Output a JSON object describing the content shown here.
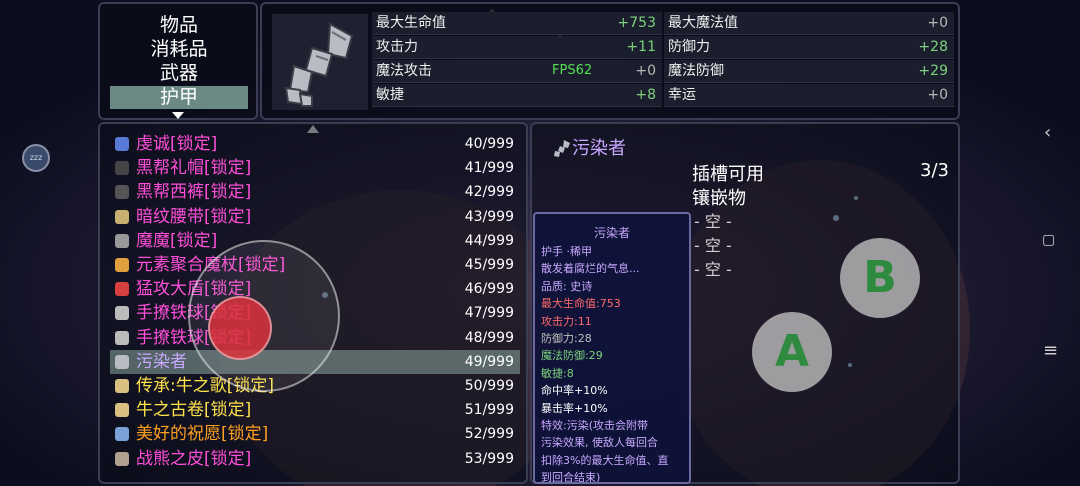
{
  "categories": [
    {
      "label": "物品",
      "selected": false
    },
    {
      "label": "消耗品",
      "selected": false
    },
    {
      "label": "武器",
      "selected": false
    },
    {
      "label": "护甲",
      "selected": true
    }
  ],
  "stats": {
    "left": [
      {
        "label": "最大生命值",
        "value": "+753",
        "color": "green"
      },
      {
        "label": "攻击力",
        "value": "+11",
        "color": "green"
      },
      {
        "label": "魔法攻击",
        "value": "+0",
        "color": "gray"
      },
      {
        "label": "敏捷",
        "value": "+8",
        "color": "green"
      }
    ],
    "right": [
      {
        "label": "最大魔法值",
        "value": "+0",
        "color": "gray"
      },
      {
        "label": "防御力",
        "value": "+28",
        "color": "green"
      },
      {
        "label": "魔法防御",
        "value": "+29",
        "color": "green"
      },
      {
        "label": "幸运",
        "value": "+0",
        "color": "gray"
      }
    ],
    "fps": "FPS62"
  },
  "items": [
    {
      "name": "虔诚[锁定]",
      "count": "40/999",
      "color": "#ff4fd8",
      "icon": "blue-robe-icon",
      "selected": false
    },
    {
      "name": "黑帮礼帽[锁定]",
      "count": "41/999",
      "color": "#ff4fd8",
      "icon": "top-hat-icon",
      "selected": false
    },
    {
      "name": "黑帮西裤[锁定]",
      "count": "42/999",
      "color": "#ff4fd8",
      "icon": "trousers-icon",
      "selected": false
    },
    {
      "name": "暗纹腰带[锁定]",
      "count": "43/999",
      "color": "#ff4fd8",
      "icon": "belt-icon",
      "selected": false
    },
    {
      "name": "魔魔[锁定]",
      "count": "44/999",
      "color": "#ff4fd8",
      "icon": "wand-icon",
      "selected": false
    },
    {
      "name": "元素聚合魔杖[锁定]",
      "count": "45/999",
      "color": "#ff4fd8",
      "icon": "magic-staff-icon",
      "selected": false
    },
    {
      "name": "猛攻大盾[锁定]",
      "count": "46/999",
      "color": "#ff4fd8",
      "icon": "shield-icon",
      "selected": false
    },
    {
      "name": "手撩铁球[锁定]",
      "count": "47/999",
      "color": "#ff4fd8",
      "icon": "iron-ball-icon",
      "selected": false
    },
    {
      "name": "手撩铁球[锁定]",
      "count": "48/999",
      "color": "#ff4fd8",
      "icon": "iron-ball-icon",
      "selected": false
    },
    {
      "name": "污染者",
      "count": "49/999",
      "color": "#c8a8ff",
      "icon": "gauntlet-icon",
      "selected": true
    },
    {
      "name": "传承:牛之歌[锁定]",
      "count": "50/999",
      "color": "#ffe14a",
      "icon": "scroll-icon",
      "selected": false
    },
    {
      "name": "牛之古卷[锁定]",
      "count": "51/999",
      "color": "#ffe14a",
      "icon": "scroll-icon",
      "selected": false
    },
    {
      "name": "美好的祝愿[锁定]",
      "count": "52/999",
      "color": "#ffa020",
      "icon": "ring-icon",
      "selected": false
    },
    {
      "name": "战熊之皮[锁定]",
      "count": "53/999",
      "color": "#ff4fd8",
      "icon": "bear-skin-icon",
      "selected": false
    }
  ],
  "detail": {
    "name": "污染者",
    "slot_title_1": "插槽可用",
    "slot_title_2": "镶嵌物",
    "slot_count": "3/3",
    "slots": [
      "- 空 -",
      "- 空 -",
      "- 空 -"
    ]
  },
  "tooltip": {
    "title": "污染者",
    "lines": [
      {
        "text": "护手 ·稀甲",
        "color": "#c8a8ff"
      },
      {
        "text": "散发着腐烂的气息...",
        "color": "#c8a8ff"
      },
      {
        "text": "品质: 史诗",
        "color": "#c8a8ff"
      },
      {
        "text": "最大生命值:753",
        "color": "#ff6a6a"
      },
      {
        "text": "攻击力:11",
        "color": "#ff6a6a"
      },
      {
        "text": "防御力:28",
        "color": "#c0c0c0"
      },
      {
        "text": "魔法防御:29",
        "color": "#7cd27c"
      },
      {
        "text": "敏捷:8",
        "color": "#7cd27c"
      },
      {
        "text": "命中率+10%",
        "color": "#ffffff"
      },
      {
        "text": "暴击率+10%",
        "color": "#ffffff"
      },
      {
        "text": "特效:污染(攻击会附带",
        "color": "#c8a8ff"
      },
      {
        "text": "污染效果, 使敌人每回合",
        "color": "#c8a8ff"
      },
      {
        "text": "扣除3%的最大生命值、直",
        "color": "#c8a8ff"
      },
      {
        "text": "到回合结束)",
        "color": "#c8a8ff"
      }
    ]
  },
  "buttons": {
    "a": "A",
    "b": "B"
  },
  "overlay": {
    "zzz": "zzz"
  }
}
